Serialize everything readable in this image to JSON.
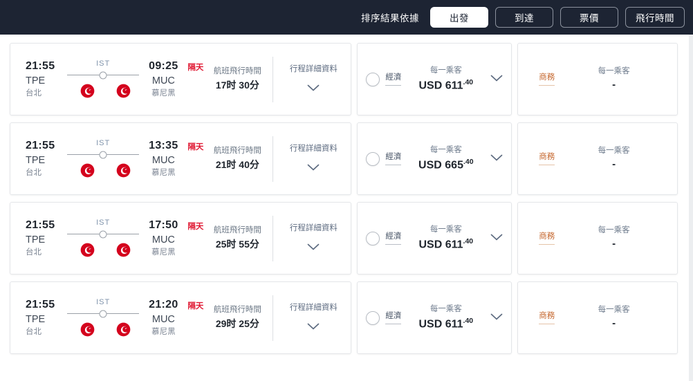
{
  "sortbar": {
    "label": "排序結果依據",
    "options": [
      {
        "label": "出發",
        "active": true
      },
      {
        "label": "到達",
        "active": false
      },
      {
        "label": "票價",
        "active": false
      },
      {
        "label": "飛行時間",
        "active": false
      }
    ]
  },
  "common": {
    "origin_code": "TPE",
    "origin_city": "台北",
    "dest_code": "MUC",
    "dest_city": "慕尼黑",
    "stop_label": "IST",
    "next_day": "隔天",
    "duration_label": "航班飛行時間",
    "details_label": "行程詳細資料",
    "per_passenger": "每一乘客",
    "cabin_economy": "經濟",
    "cabin_business": "商務",
    "business_price": "-",
    "airline_icon": "turkish-airlines-logo",
    "chevron_icon": "chevron-down-icon",
    "accent_red": "#e01933",
    "bar_background": "#1d2433",
    "business_color": "#c4642a"
  },
  "flights": [
    {
      "depart_time": "21:55",
      "arrive_time": "09:25",
      "duration": "17时 30分",
      "economy_currency": "USD",
      "economy_amount": "611",
      "economy_cents": ".40"
    },
    {
      "depart_time": "21:55",
      "arrive_time": "13:35",
      "duration": "21时 40分",
      "economy_currency": "USD",
      "economy_amount": "665",
      "economy_cents": ".40"
    },
    {
      "depart_time": "21:55",
      "arrive_time": "17:50",
      "duration": "25时 55分",
      "economy_currency": "USD",
      "economy_amount": "611",
      "economy_cents": ".40"
    },
    {
      "depart_time": "21:55",
      "arrive_time": "21:20",
      "duration": "29时 25分",
      "economy_currency": "USD",
      "economy_amount": "611",
      "economy_cents": ".40"
    }
  ]
}
